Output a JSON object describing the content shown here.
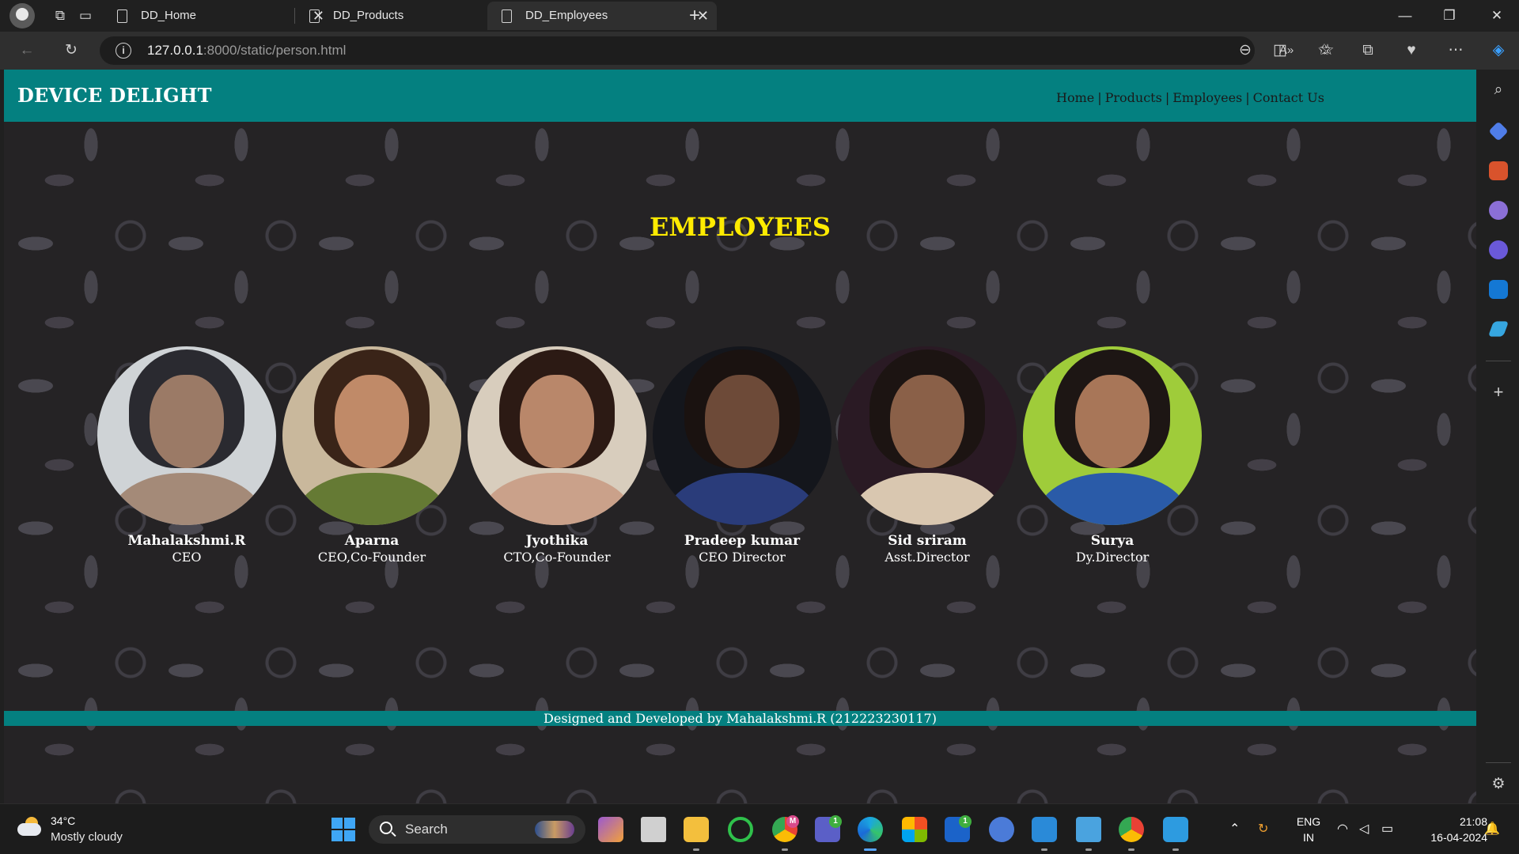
{
  "browser": {
    "tabs": [
      {
        "title": "DD_Home",
        "active": false
      },
      {
        "title": "DD_Products",
        "active": false
      },
      {
        "title": "DD_Employees",
        "active": true
      }
    ],
    "address_bar": {
      "host": "127.0.0.1",
      "path": ":8000/static/person.html"
    }
  },
  "site": {
    "brand": "DEVICE DELIGHT",
    "nav": [
      "Home",
      "Products",
      "Employees",
      "Contact Us"
    ],
    "nav_separator": "|",
    "page_title": "EMPLOYEES",
    "employees": [
      {
        "name": "Mahalakshmi.R",
        "role": "CEO"
      },
      {
        "name": "Aparna",
        "role": "CEO,Co-Founder"
      },
      {
        "name": "Jyothika",
        "role": "CTO,Co-Founder"
      },
      {
        "name": "Pradeep kumar",
        "role": "CEO Director"
      },
      {
        "name": "Sid sriram",
        "role": "Asst.Director"
      },
      {
        "name": "Surya",
        "role": "Dy.Director"
      }
    ],
    "footer": "Designed and Developed by Mahalakshmi.R (212223230117)",
    "colors": {
      "header": "#048080",
      "title": "#ffeb00",
      "background": "#252325"
    }
  },
  "taskbar": {
    "weather": {
      "temp": "34°C",
      "desc": "Mostly cloudy"
    },
    "search_label": "Search",
    "tray": {
      "lang_top": "ENG",
      "lang_bottom": "IN",
      "time": "21:08",
      "date": "16-04-2024"
    },
    "badges": {
      "chrome_profile": "M",
      "teams": "1",
      "lens": "1"
    }
  }
}
